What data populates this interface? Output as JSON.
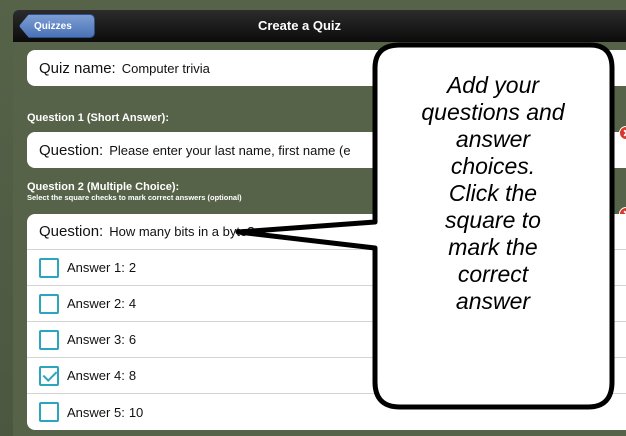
{
  "navbar": {
    "back_label": "Quizzes",
    "title": "Create a Quiz"
  },
  "quiz_name": {
    "label": "Quiz name:",
    "value": "Computer trivia"
  },
  "question1": {
    "header": "Question 1 (Short Answer):",
    "label": "Question:",
    "value": "Please enter your last name, first name (e"
  },
  "question2": {
    "header": "Question 2 (Multiple Choice):",
    "subheader": "Select the square checks to mark correct answers (optional)",
    "label": "Question:",
    "value": "How many bits in a byte?",
    "answers": [
      {
        "label": "Answer 1:",
        "value": "2",
        "checked": false
      },
      {
        "label": "Answer 2:",
        "value": "4",
        "checked": false
      },
      {
        "label": "Answer 3:",
        "value": "6",
        "checked": false
      },
      {
        "label": "Answer 4:",
        "value": "8",
        "checked": true
      },
      {
        "label": "Answer 5:",
        "value": "10",
        "checked": false
      }
    ]
  },
  "callout": {
    "lines": [
      "Add your",
      "questions and",
      "answer",
      "choices.",
      "Click the",
      "square to",
      "mark the",
      "correct",
      "answer"
    ]
  },
  "colors": {
    "checkbox": "#2aa5bc",
    "delete": "#d8372c",
    "background": "#566349"
  }
}
